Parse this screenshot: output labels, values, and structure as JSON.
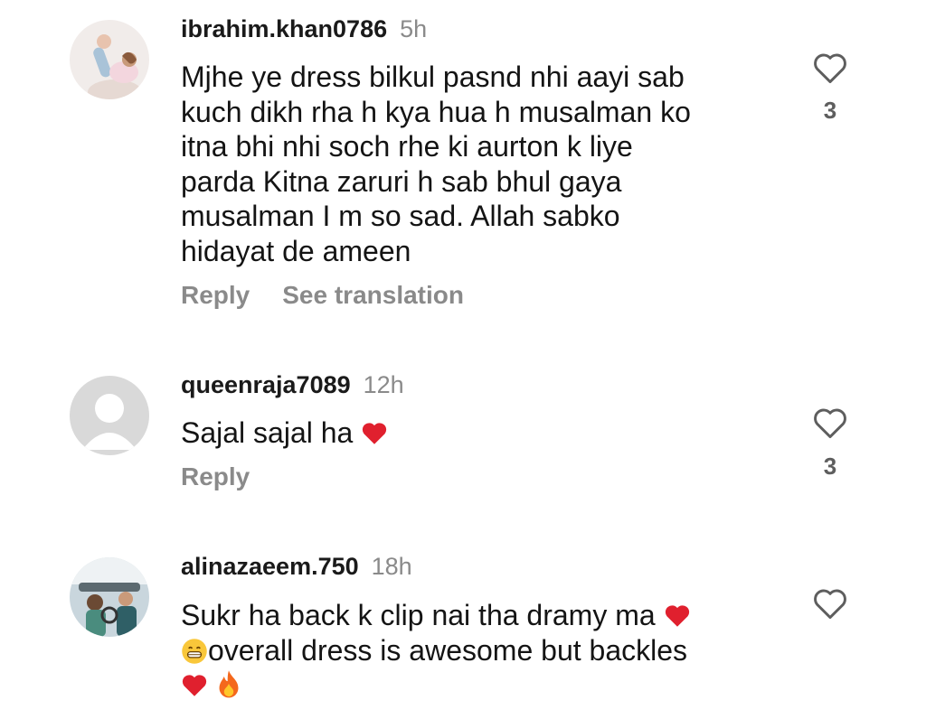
{
  "comments": [
    {
      "username": "ibrahim.khan0786",
      "time": "5h",
      "lines": [
        "Mjhe ye dress bilkul pasnd nhi aayi sab",
        "kuch dikh rha h kya hua h musalman ko",
        "itna bhi nhi soch rhe ki aurton k liye",
        "parda Kitna zaruri h sab bhul gaya",
        "musalman I m so sad. Allah sabko",
        "hidayat de ameen"
      ],
      "reply_label": "Reply",
      "translate_label": "See translation",
      "likes": "3"
    },
    {
      "username": "queenraja7089",
      "time": "12h",
      "text": "Sajal sajal ha",
      "reply_label": "Reply",
      "likes": "3"
    },
    {
      "username": "alinazaeem.750",
      "time": "18h",
      "line1": "Sukr ha back k clip nai tha dramy ma",
      "line2": "overall dress is awesome but backles"
    }
  ],
  "icons": {
    "like": "heart-outline-icon",
    "heart_emoji": "red-heart-emoji",
    "grin_emoji": "grinning-face-emoji",
    "fire_emoji": "fire-emoji"
  },
  "colors": {
    "username": "#1a1a1a",
    "meta": "#8a8a8a",
    "heart_emoji": "#e0202e"
  }
}
